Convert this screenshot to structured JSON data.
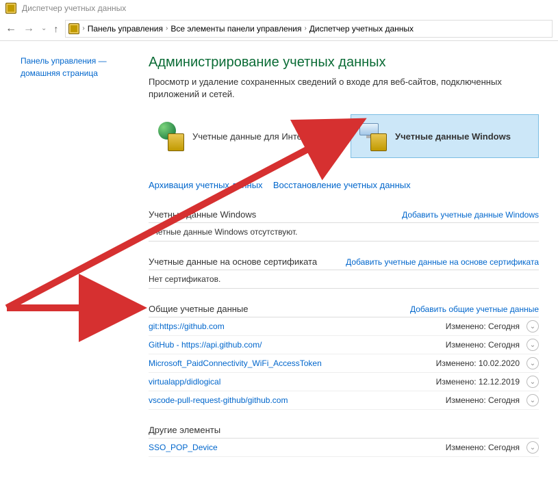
{
  "window": {
    "title": "Диспетчер учетных данных"
  },
  "breadcrumb": {
    "items": [
      "Панель управления",
      "Все элементы панели управления",
      "Диспетчер учетных данных"
    ]
  },
  "sidebar": {
    "home_link": "Панель управления — домашняя страница"
  },
  "main": {
    "title": "Администрирование учетных данных",
    "description": "Просмотр и удаление сохраненных сведений о входе для веб-сайтов, подключенных приложений и сетей.",
    "tiles": [
      {
        "label": "Учетные данные для Интернета"
      },
      {
        "label": "Учетные данные Windows"
      }
    ],
    "actions": [
      {
        "label": "Архивация учетных данных"
      },
      {
        "label": "Восстановление учетных данных"
      }
    ],
    "sections": [
      {
        "title": "Учетные данные Windows",
        "add_label": "Добавить учетные данные Windows",
        "empty": "Учетные данные Windows отсутствуют.",
        "entries": []
      },
      {
        "title": "Учетные данные на основе сертификата",
        "add_label": "Добавить учетные данные на основе сертификата",
        "empty": "Нет сертификатов.",
        "entries": []
      },
      {
        "title": "Общие учетные данные",
        "add_label": "Добавить общие учетные данные",
        "empty": null,
        "entries": [
          {
            "name": "git:https://github.com",
            "modified_label": "Изменено:",
            "modified_value": "Сегодня"
          },
          {
            "name": "GitHub - https://api.github.com/",
            "modified_label": "Изменено:",
            "modified_value": "Сегодня"
          },
          {
            "name": "Microsoft_PaidConnectivity_WiFi_AccessToken",
            "modified_label": "Изменено:",
            "modified_value": "10.02.2020"
          },
          {
            "name": "virtualapp/didlogical",
            "modified_label": "Изменено:",
            "modified_value": "12.12.2019"
          },
          {
            "name": "vscode-pull-request-github/github.com",
            "modified_label": "Изменено:",
            "modified_value": "Сегодня"
          }
        ]
      },
      {
        "title": "Другие элементы",
        "add_label": null,
        "empty": null,
        "entries": [
          {
            "name": "SSO_POP_Device",
            "modified_label": "Изменено:",
            "modified_value": "Сегодня"
          }
        ]
      }
    ]
  }
}
